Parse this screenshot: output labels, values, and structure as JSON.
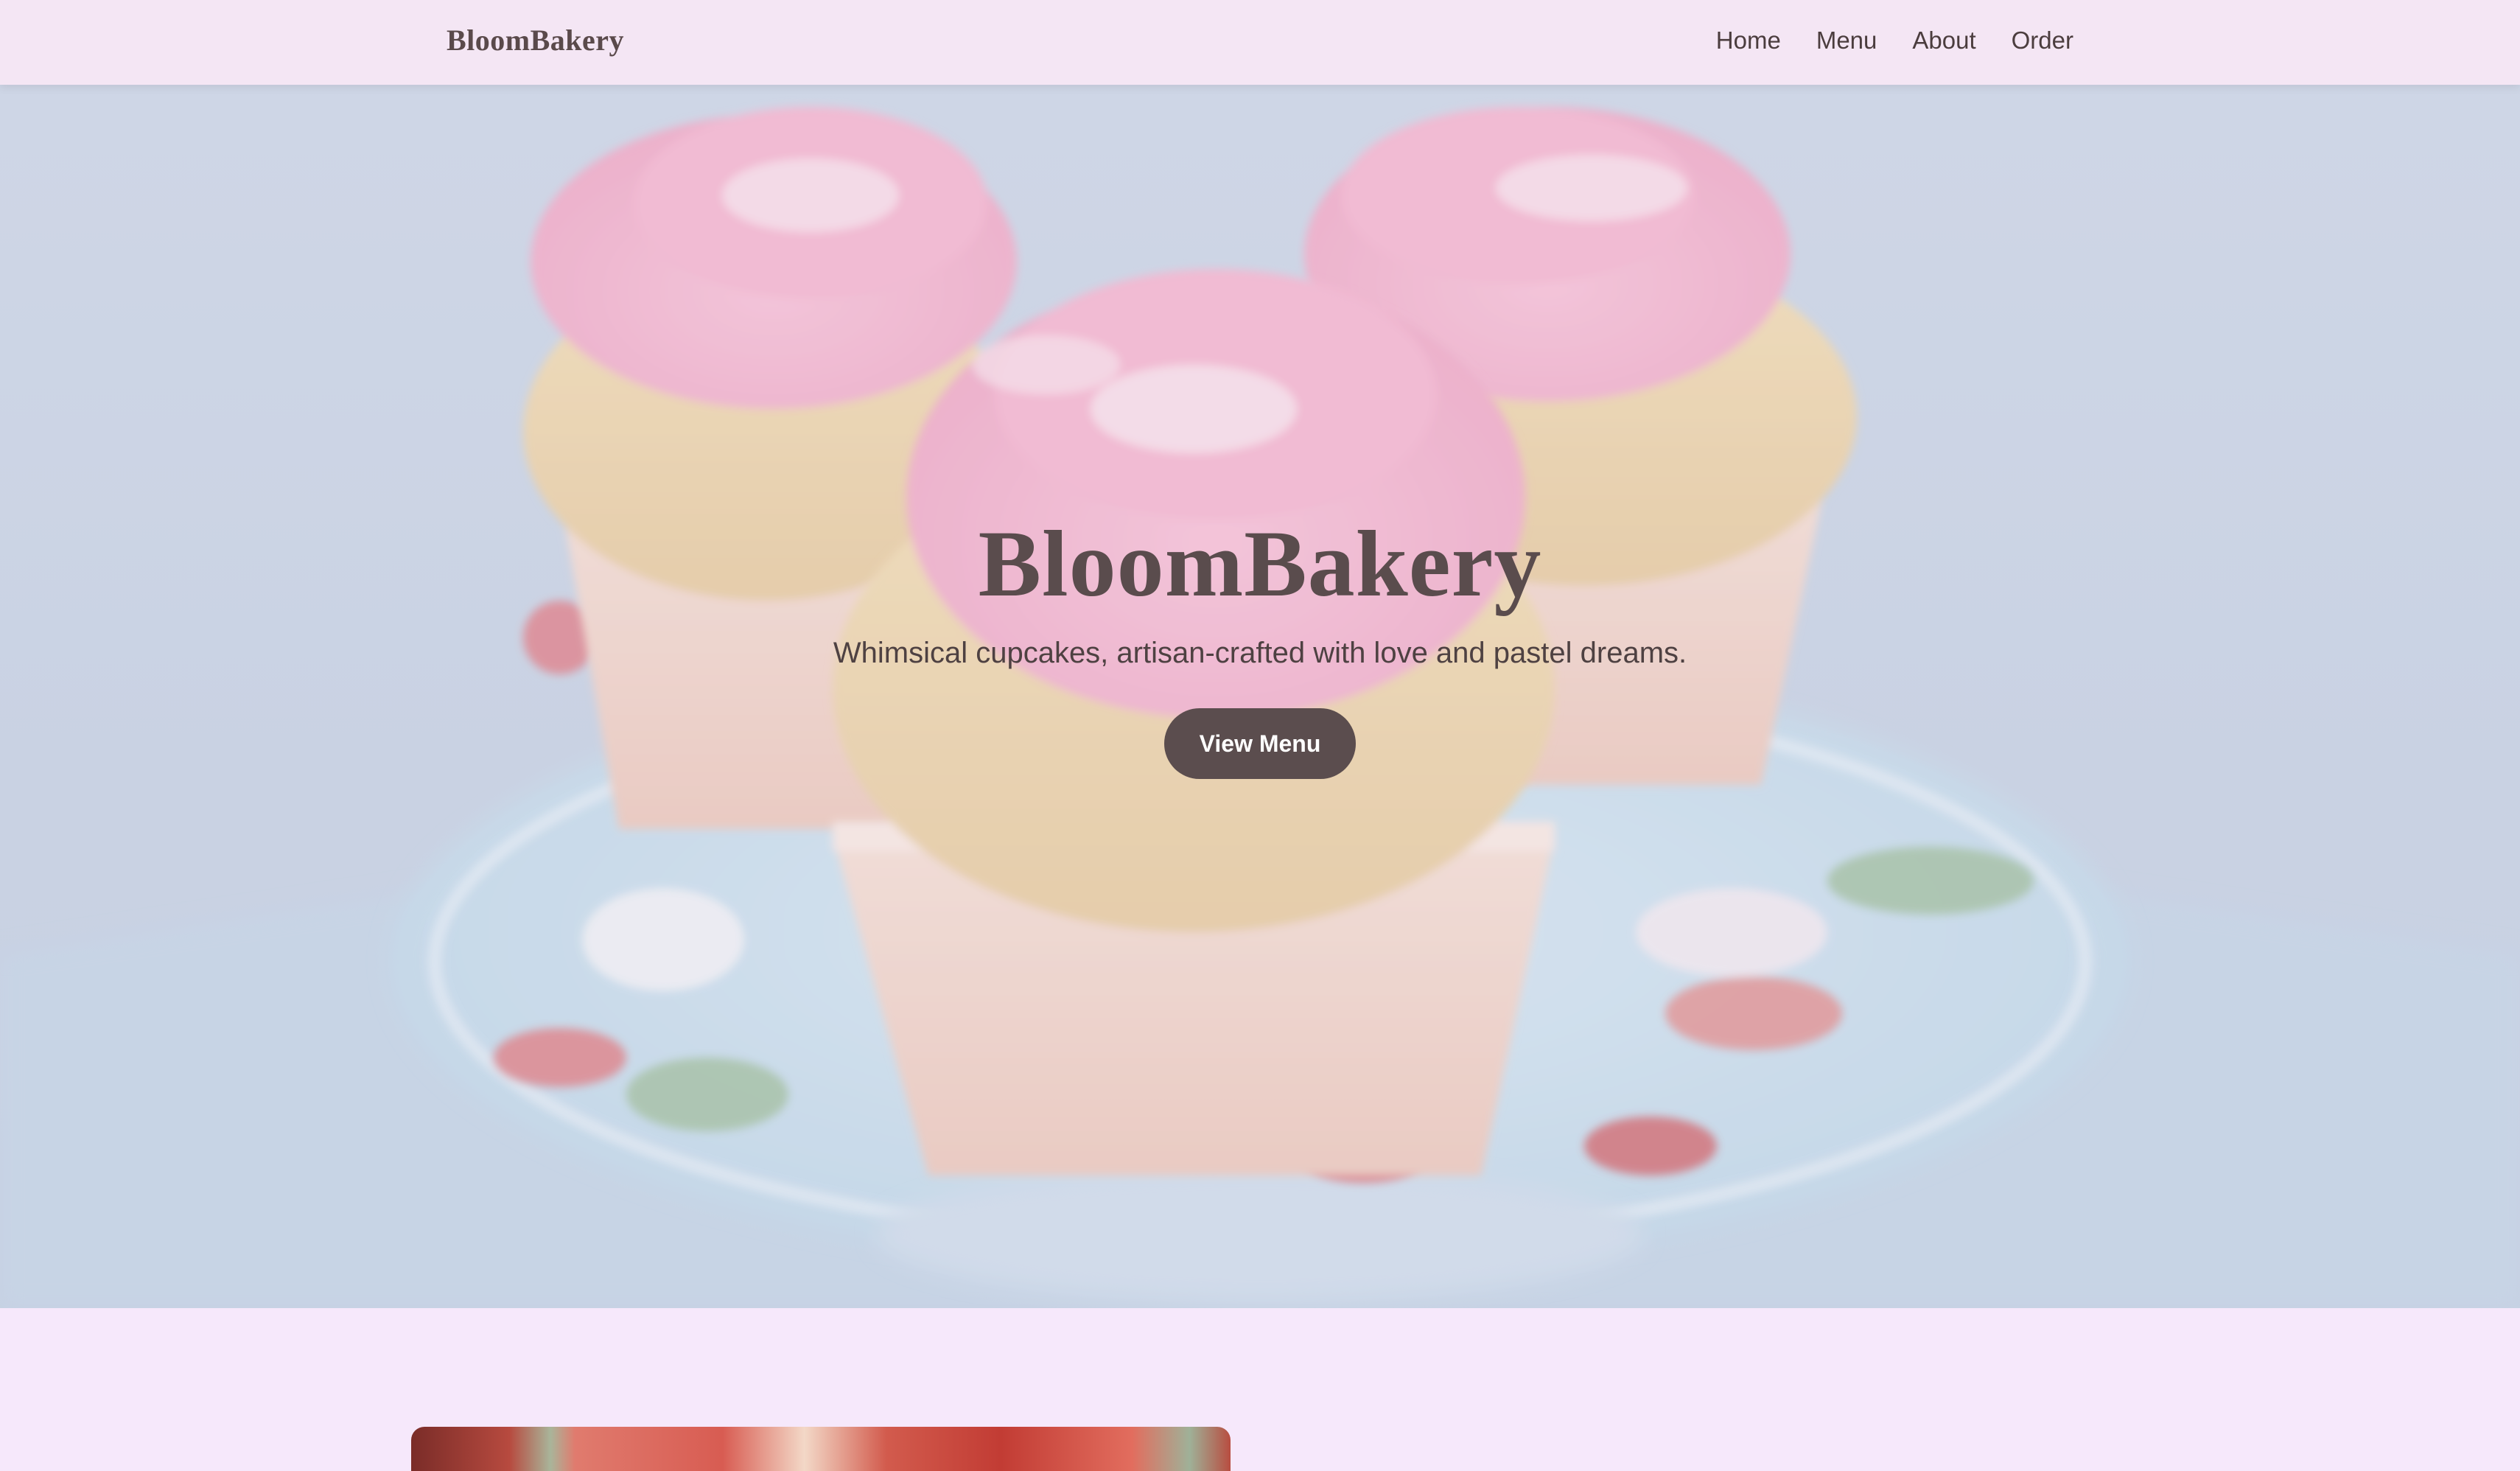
{
  "navbar": {
    "brand": "BloomBakery",
    "links": [
      {
        "label": "Home"
      },
      {
        "label": "Menu"
      },
      {
        "label": "About"
      },
      {
        "label": "Order"
      }
    ]
  },
  "hero": {
    "title": "BloomBakery",
    "tagline": "Whimsical cupcakes, artisan-crafted with love and pastel dreams.",
    "button_label": "View Menu",
    "background_image": "cupcakes-on-cake-stand"
  },
  "section": {
    "feature_image": "bakery-interior-photo"
  },
  "colors": {
    "page_background": "#f6e8fb",
    "navbar_background": "#f4e6f4",
    "text": "#5a4a4b",
    "button": "#5b4d4e",
    "frosting_pink": "#f2a7c3",
    "hero_sky": "#c3cfe1"
  }
}
